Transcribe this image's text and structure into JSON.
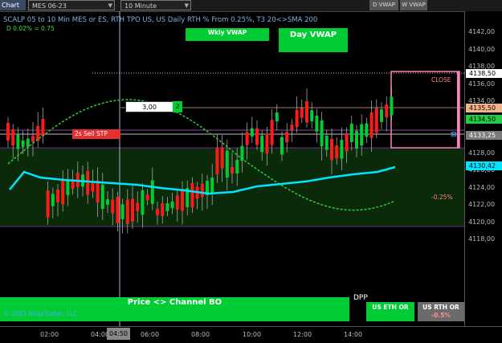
{
  "toolbar": {
    "chart_tab": "Chart",
    "instrument": "MES 06-23",
    "period": "10 Minute",
    "vwap_btn": "D VWAP",
    "wvwap_btn": "W VWAP"
  },
  "indicator": {
    "title": "SCALP 05 to 10 Min MES or ES, RTH TPO US, US Daily RTH % From 0.25%, T3 20<>SMA 200",
    "subtitle": "D 0.02% = 0.75"
  },
  "buttons": {
    "wkly_vwap": "Wkly VWAP",
    "day_vwap": "Day VWAP",
    "channel_bo": "Price <> Channel BO",
    "us_eth_line1": "US ETH OR",
    "us_eth_line2": "",
    "us_rth_line1": "US RTH OR",
    "us_rth_line2": "-0.5%"
  },
  "order": {
    "qty": "3,00",
    "qty_tag": "2",
    "sell_stop": "2s  Sell STP"
  },
  "labels": {
    "close": "CLOSE",
    "pct": "-0.25%",
    "dpp": "DPP",
    "copyright": "© 2023 NinjaTrader, LLC"
  },
  "price_tags": {
    "high": "4138,50",
    "p1": "4135,50",
    "p2": "4134,50",
    "p3": "4133,25",
    "sma": "4130,42"
  },
  "y_axis": [
    "4142,00",
    "4140,00",
    "4138,00",
    "4136,00",
    "4134,00",
    "4132,00",
    "4130,00",
    "4128,00",
    "4126,00",
    "4124,00",
    "4122,00",
    "4120,00",
    "4118,00"
  ],
  "x_axis": [
    "02:00",
    "04:00",
    "06:00",
    "08:00",
    "10:00",
    "12:00",
    "14:00"
  ],
  "cursor_time": "04:50",
  "colors": {
    "up_candle": "#00cc33",
    "down_candle": "#ff1a1a",
    "sma_line": "#00e5ff",
    "t3_line": "#33cc33",
    "channel_fill": "#0a2a0a",
    "channel_border": "#6a2a90"
  }
}
